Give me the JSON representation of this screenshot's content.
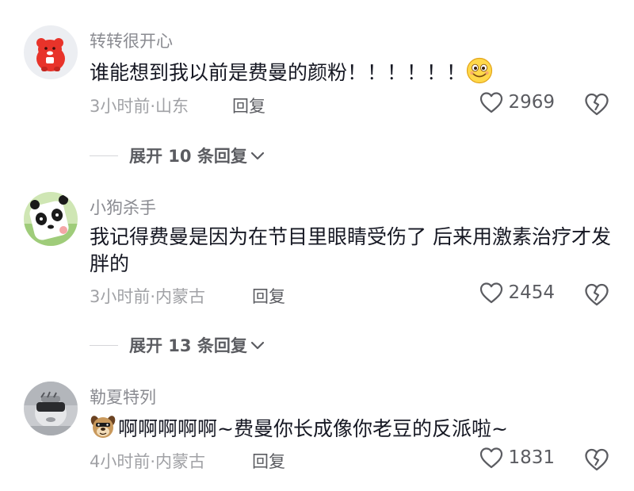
{
  "comments": [
    {
      "username": "转转很开心",
      "text": "谁能想到我以前是费曼的颜粉！！！！！！",
      "emoji_icon": "smiley-face-icon",
      "meta": "3小时前·山东",
      "reply_label": "回复",
      "likes": "2969"
    },
    {
      "username": "小狗杀手",
      "text": "我记得费曼是因为在节目里眼睛受伤了 后来用激素治疗才发胖的",
      "meta": "3小时前·内蒙古",
      "reply_label": "回复",
      "likes": "2454"
    },
    {
      "username": "勒夏特列",
      "text": "啊啊啊啊啊~费曼你长成像你老豆的反派啦~",
      "emoji_icon": "dog-face-icon",
      "meta": "4小时前·内蒙古",
      "reply_label": "回复",
      "likes": "1831"
    }
  ],
  "expanders": [
    {
      "label": "展开 10 条回复"
    },
    {
      "label": "展开 13 条回复"
    }
  ],
  "colors": {
    "primary_text": "#161823",
    "secondary_text": "#8a8b91",
    "meta_text": "#a1a2a6",
    "action_text": "#5b5c61"
  }
}
